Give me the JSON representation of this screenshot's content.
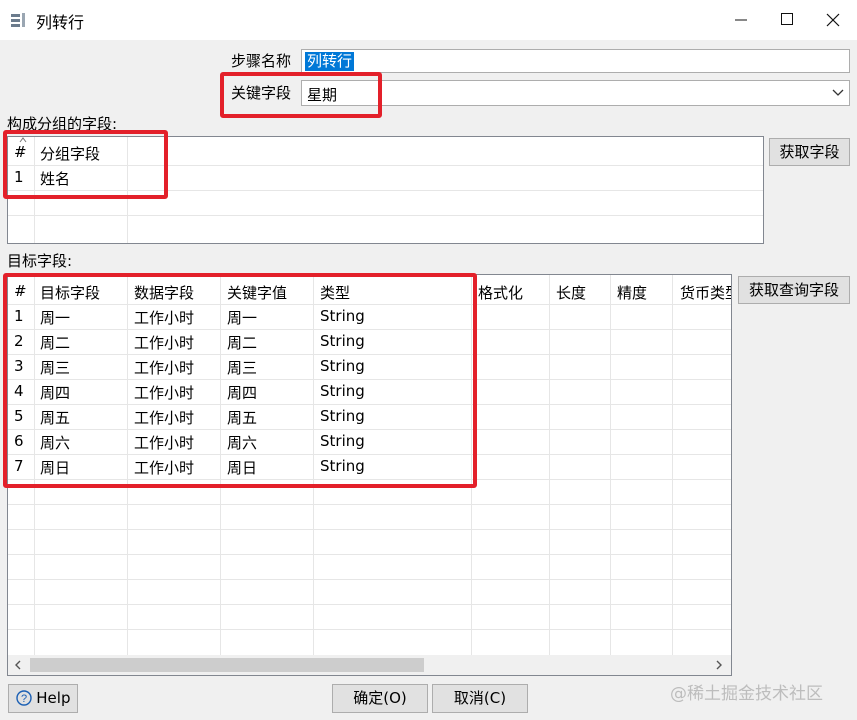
{
  "window": {
    "title": "列转行",
    "minimize": "—",
    "maximize": "☐",
    "close": "✕"
  },
  "form": {
    "step_name_label": "步骤名称",
    "step_name_value": "列转行",
    "key_field_label": "关键字段",
    "key_field_value": "星期"
  },
  "group": {
    "section_label": "构成分组的字段:",
    "headers": [
      "#",
      "分组字段"
    ],
    "rows": [
      [
        "1",
        "姓名"
      ]
    ],
    "get_fields_button": "获取字段"
  },
  "target": {
    "section_label": "目标字段:",
    "headers": [
      "#",
      "目标字段",
      "数据字段",
      "关键字值",
      "类型",
      "格式化",
      "长度",
      "精度",
      "货币类型"
    ],
    "rows": [
      [
        "1",
        "周一",
        "工作小时",
        "周一",
        "String"
      ],
      [
        "2",
        "周二",
        "工作小时",
        "周二",
        "String"
      ],
      [
        "3",
        "周三",
        "工作小时",
        "周三",
        "String"
      ],
      [
        "4",
        "周四",
        "工作小时",
        "周四",
        "String"
      ],
      [
        "5",
        "周五",
        "工作小时",
        "周五",
        "String"
      ],
      [
        "6",
        "周六",
        "工作小时",
        "周六",
        "String"
      ],
      [
        "7",
        "周日",
        "工作小时",
        "周日",
        "String"
      ]
    ],
    "get_lookup_button": "获取查询字段"
  },
  "footer": {
    "help_button": "Help",
    "ok_button": "确定(O)",
    "cancel_button": "取消(C)",
    "watermark": "@稀土掘金技术社区"
  }
}
